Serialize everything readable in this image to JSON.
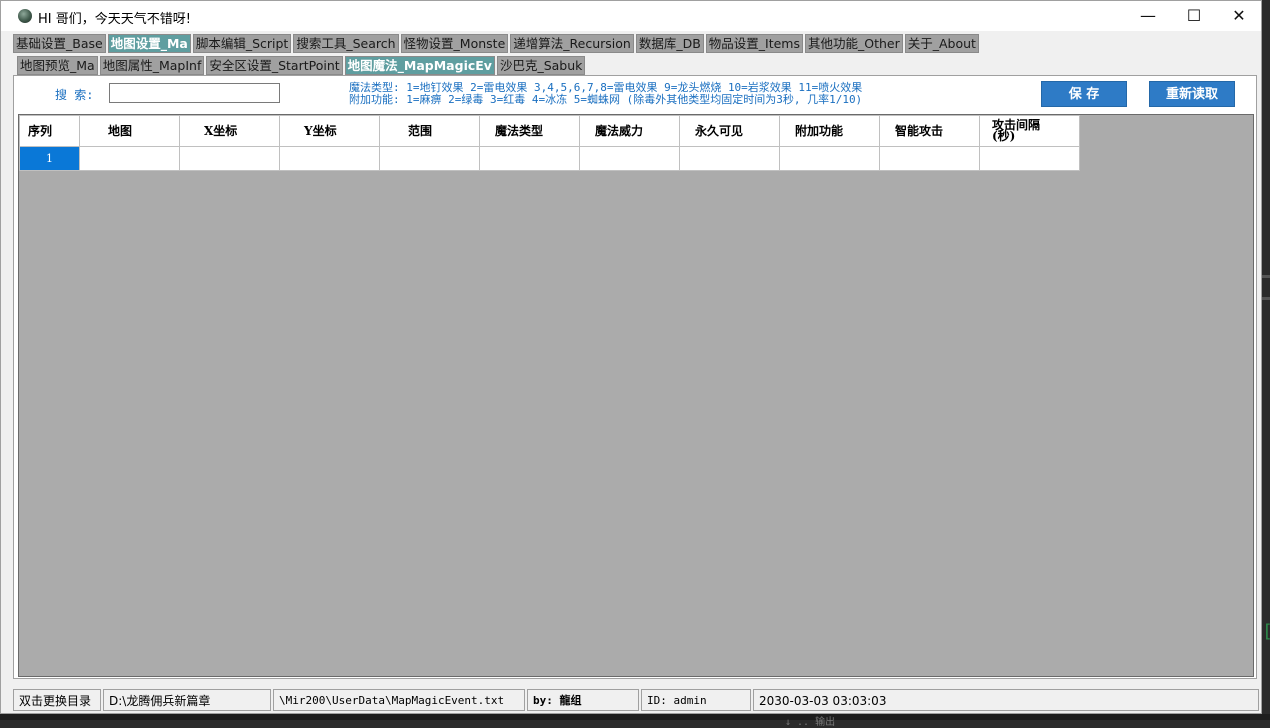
{
  "window": {
    "title": "HI 哥们，今天天气不错呀!",
    "minimize_glyph": "—",
    "maximize_glyph": "☐",
    "close_glyph": "✕"
  },
  "main_tabs": [
    {
      "label": "基础设置_Base",
      "active": false
    },
    {
      "label": "地图设置_Ma",
      "active": true
    },
    {
      "label": "脚本编辑_Script",
      "active": false
    },
    {
      "label": "搜索工具_Search",
      "active": false
    },
    {
      "label": "怪物设置_Monste",
      "active": false
    },
    {
      "label": "递增算法_Recursion",
      "active": false
    },
    {
      "label": "数据库_DB",
      "active": false
    },
    {
      "label": "物品设置_Items",
      "active": false
    },
    {
      "label": "其他功能_Other",
      "active": false
    },
    {
      "label": "关于_About",
      "active": false
    }
  ],
  "sub_tabs": [
    {
      "label": "地图预览_Ma",
      "active": false
    },
    {
      "label": "地图属性_MapInf",
      "active": false
    },
    {
      "label": "安全区设置_StartPoint",
      "active": false
    },
    {
      "label": "地图魔法_MapMagicEv",
      "active": true
    },
    {
      "label": "沙巴克_Sabuk",
      "active": false
    }
  ],
  "search": {
    "label": "搜 索:",
    "value": "",
    "placeholder": ""
  },
  "info": {
    "line1": "魔法类型: 1=地钉效果 2=雷电效果 3,4,5,6,7,8=雷电效果 9=龙头燃烧 10=岩浆效果 11=喷火效果",
    "line2": "附加功能: 1=麻痹 2=绿毒 3=红毒 4=冰冻 5=蜘蛛网 (除毒外其他类型均固定时间为3秒, 几率1/10)"
  },
  "buttons": {
    "save": "保 存",
    "reload": "重新读取"
  },
  "table": {
    "columns": [
      "序列",
      "地图",
      "X坐标",
      "Y坐标",
      "范围",
      "魔法类型",
      "魔法威力",
      "永久可见",
      "附加功能",
      "智能攻击",
      "攻击间隔(秒)"
    ],
    "rows": [
      [
        "1",
        "",
        "",
        "",
        "",
        "",
        "",
        "",
        "",
        "",
        ""
      ]
    ]
  },
  "statusbar": {
    "dir_button": "双击更换目录",
    "path": "D:\\龙腾佣兵新篇章",
    "file": "\\Mir200\\UserData\\MapMagicEvent.txt",
    "author": "by: 龍组",
    "user_id": "ID: admin",
    "datetime": "2030-03-03 03:03:03"
  },
  "background": {
    "behind_window_text": "↓ ..  输出"
  },
  "colors": {
    "active_tab": "#5f9ea0",
    "button": "#2e7bc6",
    "info_text": "#1a6fc0",
    "grid_bg": "#ababab",
    "selected_row": "#0a78d7"
  }
}
